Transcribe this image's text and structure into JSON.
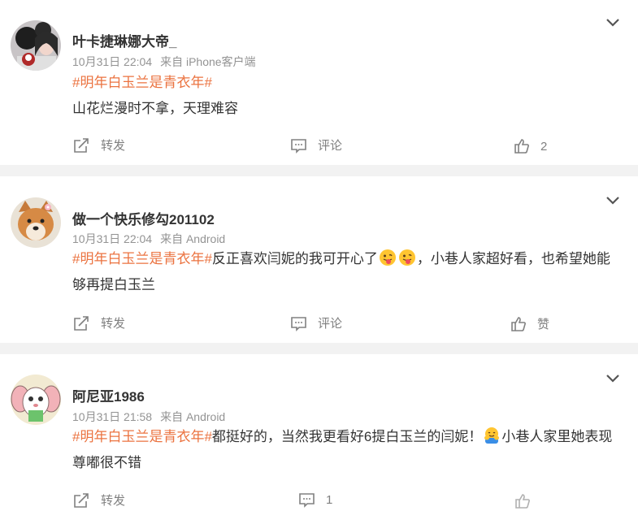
{
  "posts": [
    {
      "username": "叶卡捷琳娜大帝_",
      "time": "10月31日 22:04",
      "source": "来自 iPhone客户端",
      "hashtag": "#明年白玉兰是青衣年#",
      "text": "山花烂漫时不拿，天理难容",
      "text_after_emoji": "",
      "actions": {
        "repost": "转发",
        "comment": "评论",
        "like": "2"
      }
    },
    {
      "username": "做一个快乐修勾201102",
      "time": "10月31日 22:04",
      "source": "来自 Android",
      "hashtag": "#明年白玉兰是青衣年#",
      "text": "反正喜欢闫妮的我可开心了",
      "text_after_emoji": "，小巷人家超好看，也希望她能够再提白玉兰",
      "actions": {
        "repost": "转发",
        "comment": "评论",
        "like": "赞"
      }
    },
    {
      "username": "阿尼亚1986",
      "time": "10月31日 21:58",
      "source": "来自 Android",
      "hashtag": "#明年白玉兰是青衣年#",
      "text": "都挺好的，当然我更看好6提白玉兰的闫妮！",
      "text_after_emoji": "小巷人家里她表现尊嘟很不错",
      "actions": {
        "repost": "转发",
        "comment": "1",
        "like": ""
      }
    }
  ],
  "icons": {
    "more": "chevron-down-icon",
    "repost": "repost-icon",
    "comment": "comment-icon",
    "like": "thumbs-up-icon",
    "emoji_post2": "tongue-out-emoji-icon",
    "emoji_post3": "hug-emoji-icon"
  },
  "colors": {
    "hashtag": "#eb7340",
    "separator": "#f2f2f2",
    "meta": "#939393"
  }
}
